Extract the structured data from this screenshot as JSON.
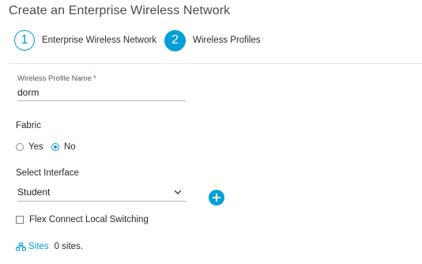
{
  "header": {
    "title": "Create an Enterprise Wireless Network"
  },
  "steps": [
    {
      "number": "1",
      "label": "Enterprise Wireless Network",
      "active": false
    },
    {
      "number": "2",
      "label": "Wireless Profiles",
      "active": true
    }
  ],
  "profile_name": {
    "label": "Wireless Profile Name",
    "required_mark": "*",
    "value": "dorm"
  },
  "fabric": {
    "label": "Fabric",
    "options": [
      {
        "label": "Yes",
        "checked": false
      },
      {
        "label": "No",
        "checked": true
      }
    ]
  },
  "interface": {
    "label": "Select Interface",
    "selected": "Student"
  },
  "flex_connect": {
    "label": "Flex Connect Local Switching",
    "checked": false
  },
  "sites": {
    "link_label": "Sites",
    "count_text": "0 sites."
  },
  "colors": {
    "accent": "#049fd9",
    "required": "#d9322b"
  },
  "icons": {
    "add": "plus-circle-icon",
    "dropdown": "chevron-down-icon",
    "sites": "sites-hierarchy-icon"
  }
}
